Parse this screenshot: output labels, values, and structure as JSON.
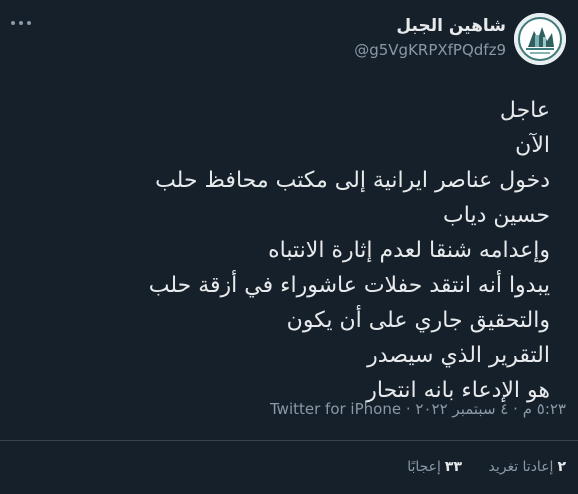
{
  "tweet": {
    "author": {
      "display_name": "شاهين الجبل",
      "handle": "@g5VgKRPXfPQdfz9"
    },
    "more_icon": "more-horizontal-icon",
    "lines": [
      "عاجل",
      "الآن",
      "دخول عناصر ايرانية إلى مكتب محافظ حلب",
      "حسين دياب",
      "وإعدامه شنقا لعدم إثارة الانتباه",
      "يبدوا أنه انتقد حفلات عاشوراء في أزقة حلب",
      "والتحقيق جاري على أن يكون",
      "التقرير الذي سيصدر",
      "هو الإدعاء بانه انتحار"
    ],
    "meta": {
      "time": "٥:٢٣ م",
      "date": "٤ سبتمبر ٢٠٢٢",
      "separator": "·",
      "source": "Twitter for iPhone"
    },
    "stats": {
      "retweets_count": "٢",
      "retweets_label": "إعادتا تغريد",
      "likes_count": "٣٣",
      "likes_label": "إعجابًا"
    }
  },
  "colors": {
    "background": "#15202b",
    "text_primary": "#e7e9ea",
    "text_secondary": "#8b98a5",
    "divider": "#38444d"
  }
}
